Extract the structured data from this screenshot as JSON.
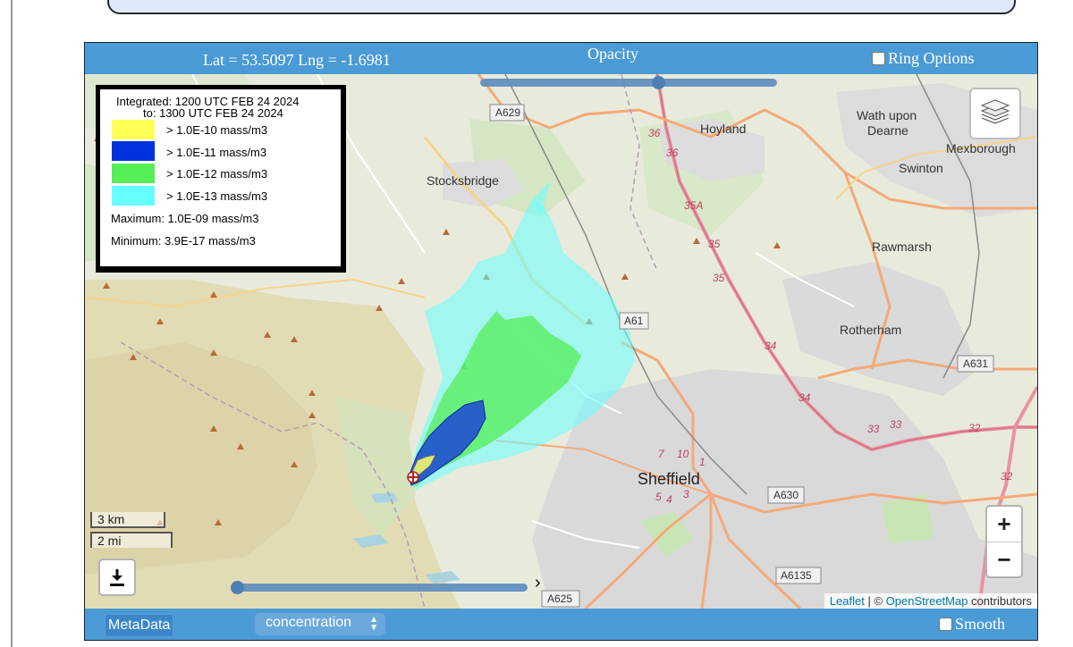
{
  "header": {
    "latlng": "Lat = 53.5097 Lng = -1.6981",
    "opacity_label": "Opacity",
    "ring_options_label": "Ring Options"
  },
  "legend": {
    "integrated_line1": "Integrated:  1200 UTC  FEB  24   2024",
    "integrated_line2": "to:  1300 UTC  FEB  24   2024",
    "items": [
      {
        "label": "> 1.0E-10 mass/m3",
        "color": "#ffff55"
      },
      {
        "label": "> 1.0E-11 mass/m3",
        "color": "#0033dd"
      },
      {
        "label": "> 1.0E-12 mass/m3",
        "color": "#55ee55"
      },
      {
        "label": "> 1.0E-13 mass/m3",
        "color": "#66ffff"
      }
    ],
    "maximum": "Maximum: 1.0E-09  mass/m3",
    "minimum": "Minimum: 3.9E-17  mass/m3"
  },
  "map": {
    "places": {
      "hoyland": "Hoyland",
      "wath1": "Wath upon",
      "wath2": "Dearne",
      "mexborough": "Mexborough",
      "swinton": "Swinton",
      "stocksbridge": "Stocksbridge",
      "rawmarsh": "Rawmarsh",
      "rotherham": "Rotherham",
      "sheffield": "Sheffield"
    },
    "roads": {
      "a629": "A629",
      "a61": "A61",
      "a631": "A631",
      "a630": "A630",
      "a6135": "A6135",
      "a625": "A625"
    },
    "junctions": {
      "j36a": "36",
      "j36b": "36",
      "j35a": "35A",
      "j35a2": "35",
      "j35b": "35",
      "j34a": "34",
      "j34b": "34",
      "j33a": "33",
      "j33b": "33",
      "j32a": "32",
      "j32b": "32",
      "j7": "7",
      "j10": "10",
      "j1": "1",
      "j5": "5",
      "j4": "4",
      "j3": "3"
    }
  },
  "scale": {
    "km": "3 km",
    "mi": "2 mi"
  },
  "zoom": {
    "in": "+",
    "out": "−"
  },
  "attribution": {
    "leaflet": "Leaflet",
    "sep": " | © ",
    "osm": "OpenStreetMap",
    "rest": " contributors"
  },
  "footer": {
    "metadata_label": "MetaData",
    "select_value": "concentration",
    "smooth_label": "Smooth"
  },
  "sliders": {
    "opacity": 0.6,
    "time": 0.0
  },
  "icons": {
    "layers": "layers-icon",
    "download": "download-icon",
    "source": "release-point-icon",
    "next": "chevron-right-icon"
  }
}
